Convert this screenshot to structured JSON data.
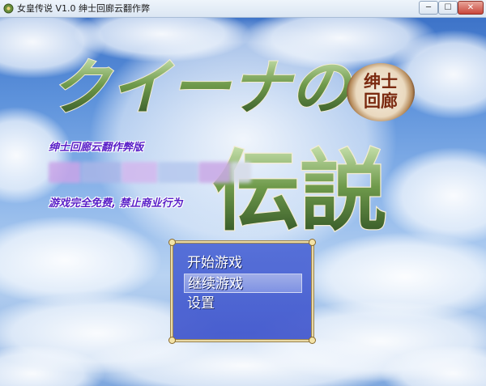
{
  "window": {
    "title": "女皇传说 V1.0 绅士回廊云翻作弊",
    "min_glyph": "─",
    "max_glyph": "☐",
    "close_glyph": "✕"
  },
  "title_art": {
    "katakana": "クイーナの",
    "kanji": "伝説",
    "badge_line1": "绅士",
    "badge_line2": "回廊"
  },
  "subtitle": "绅士回廊云翻作弊版",
  "notice": "游戏完全免费, 禁止商业行为",
  "menu": {
    "items": [
      "开始游戏",
      "继续游戏",
      "设置"
    ],
    "selected_index": 1
  },
  "colors": {
    "text_purple": "#5a20c8",
    "menu_blue": "#4e68d6",
    "menu_border": "#e9d9a6",
    "title_green": "#3d6b2a"
  }
}
